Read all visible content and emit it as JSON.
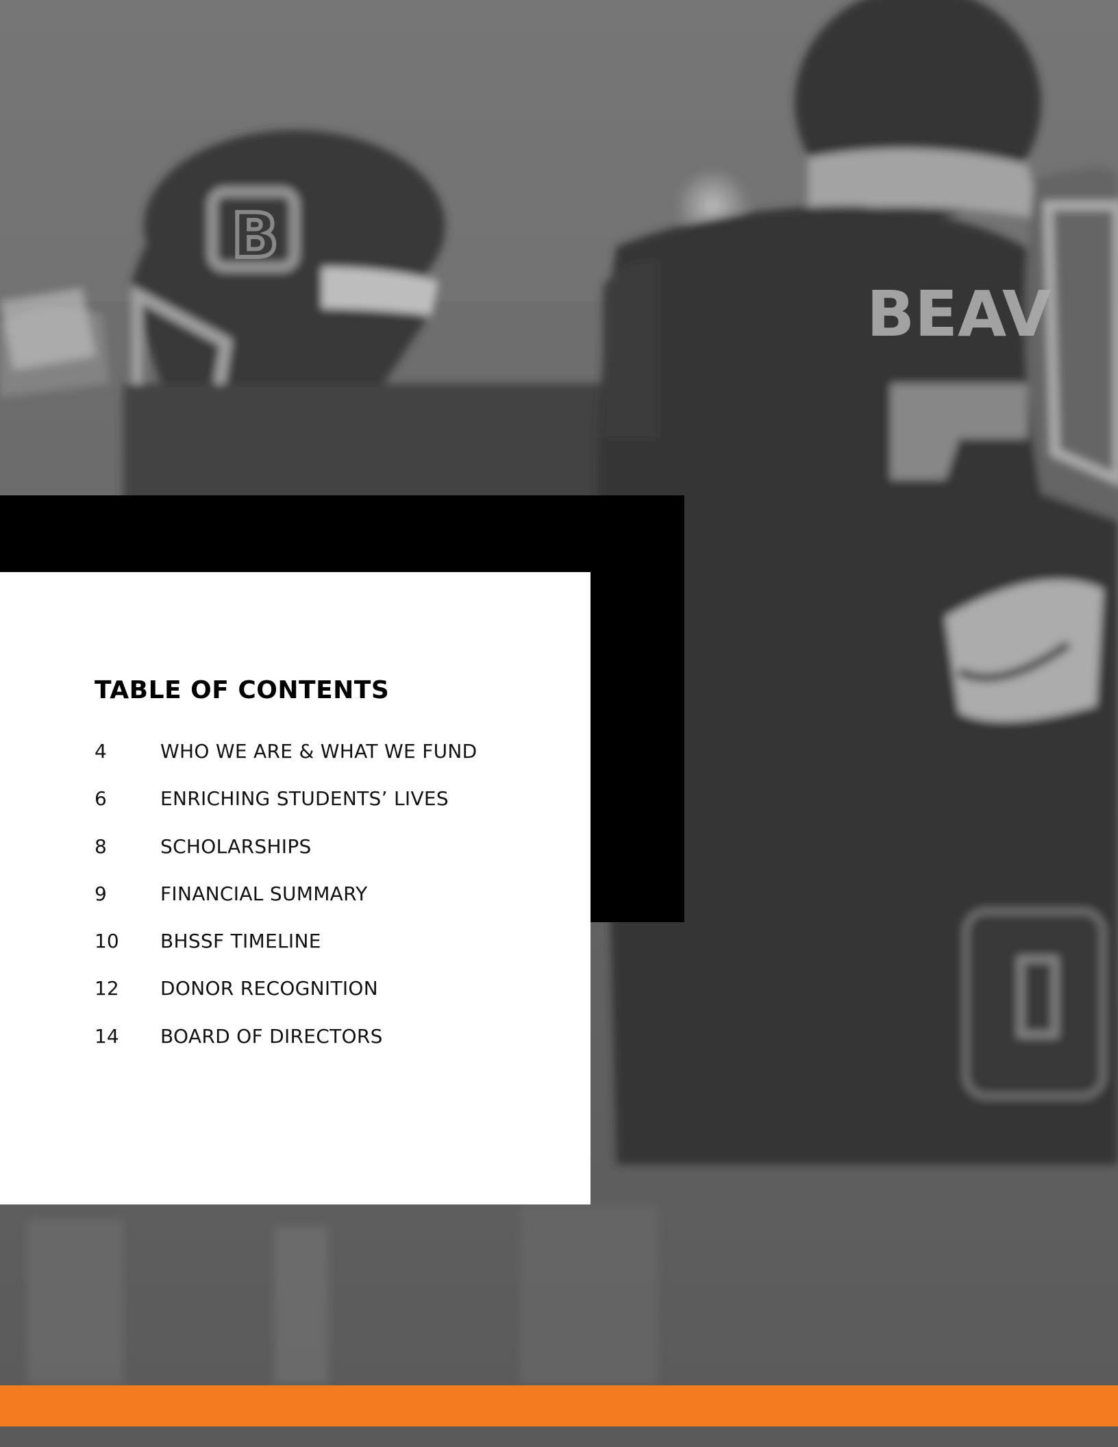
{
  "toc": {
    "title": "TABLE OF CONTENTS",
    "items": [
      {
        "page": "4",
        "label": "WHO WE ARE & WHAT WE FUND"
      },
      {
        "page": "6",
        "label": "ENRICHING STUDENTS’ LIVES"
      },
      {
        "page": "8",
        "label": "SCHOLARSHIPS"
      },
      {
        "page": "9",
        "label": "FINANCIAL SUMMARY"
      },
      {
        "page": "10",
        "label": "BHSSF TIMELINE"
      },
      {
        "page": "12",
        "label": "DONOR RECOGNITION"
      },
      {
        "page": "14",
        "label": "BOARD OF DIRECTORS"
      }
    ]
  },
  "background_photo": {
    "jersey_text": "BEAV",
    "helmet_letter": "B",
    "style": "grayscale football players"
  },
  "colors": {
    "accent": "#f47b20",
    "panel_black": "#000000",
    "panel_white": "#ffffff",
    "photo_gray": "#5c5c5c"
  }
}
